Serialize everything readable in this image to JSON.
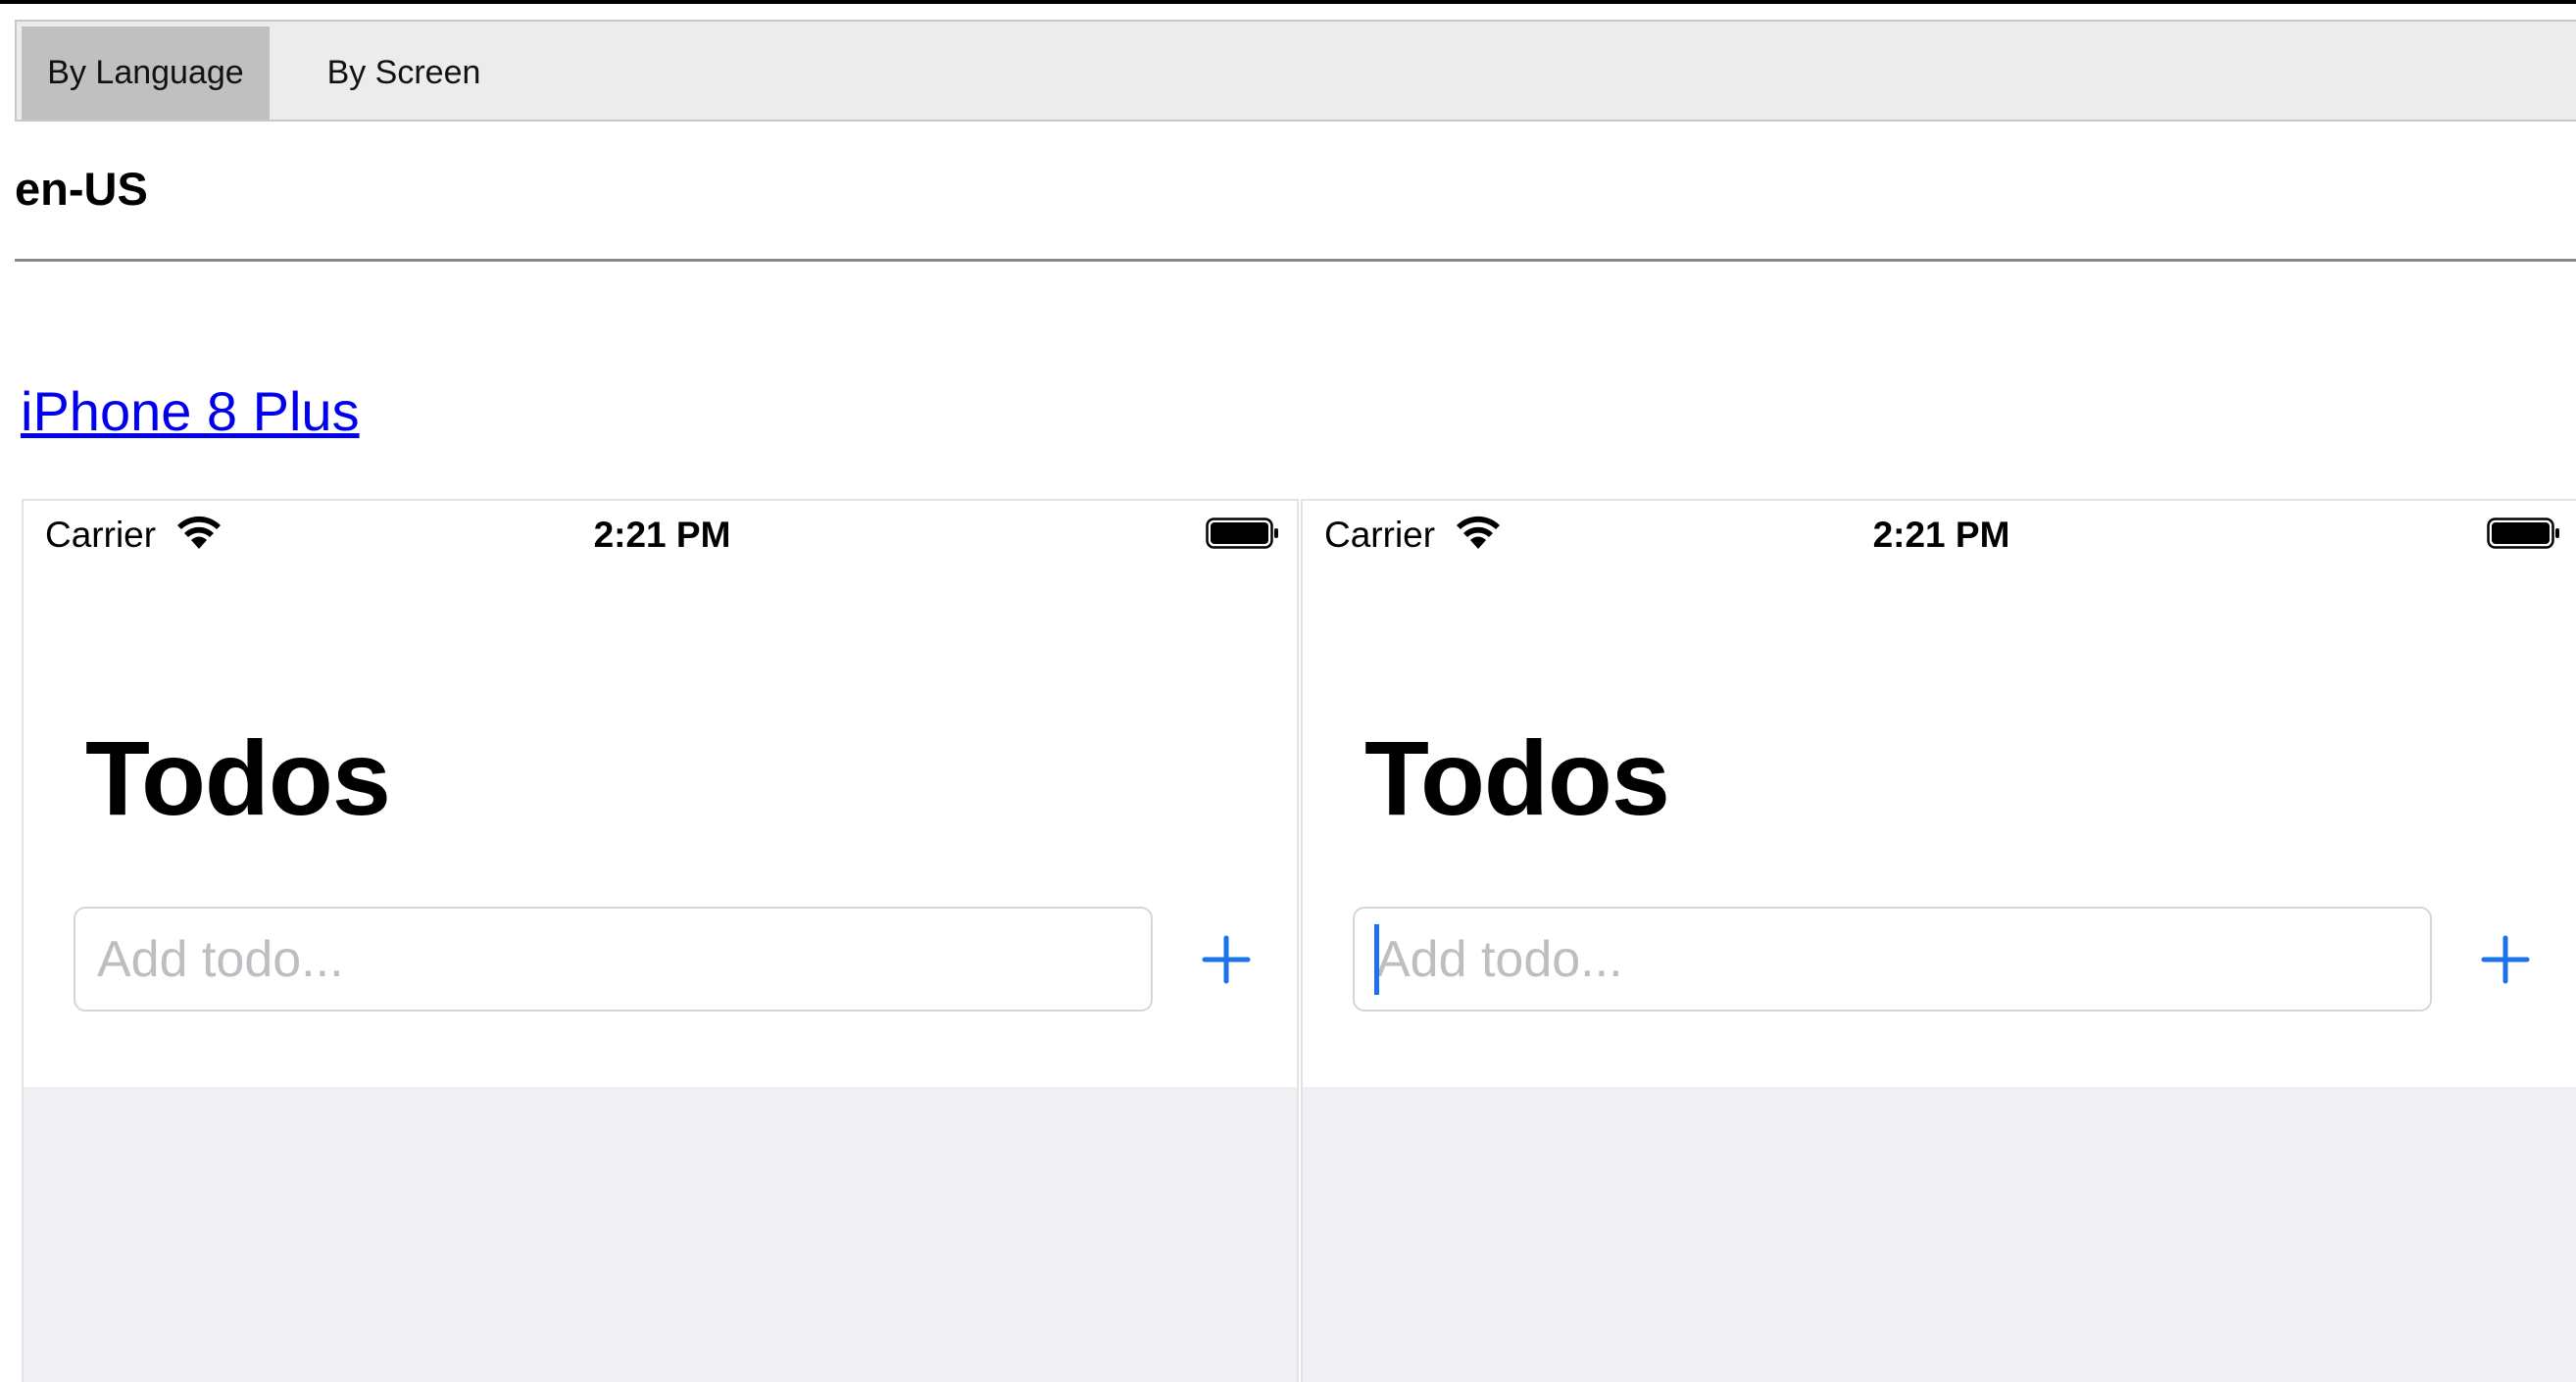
{
  "tabs": [
    {
      "label": "By Language",
      "active": true
    },
    {
      "label": "By Screen",
      "active": false
    }
  ],
  "language": "en-US",
  "device_link": "iPhone 8 Plus",
  "screens": [
    {
      "status": {
        "carrier": "Carrier",
        "time": "2:21 PM"
      },
      "title": "Todos",
      "input": {
        "placeholder": "Add todo...",
        "value": "",
        "focused": false
      },
      "add_icon": "plus-icon"
    },
    {
      "status": {
        "carrier": "Carrier",
        "time": "2:21 PM"
      },
      "title": "Todos",
      "input": {
        "placeholder": "Add todo...",
        "value": "",
        "focused": true
      },
      "add_icon": "plus-icon"
    }
  ],
  "colors": {
    "link": "#0000ee",
    "accent": "#1a73e8",
    "active_tab": "#c0c0c0",
    "tabbar": "#ececec",
    "table_background": "#efeff4"
  }
}
